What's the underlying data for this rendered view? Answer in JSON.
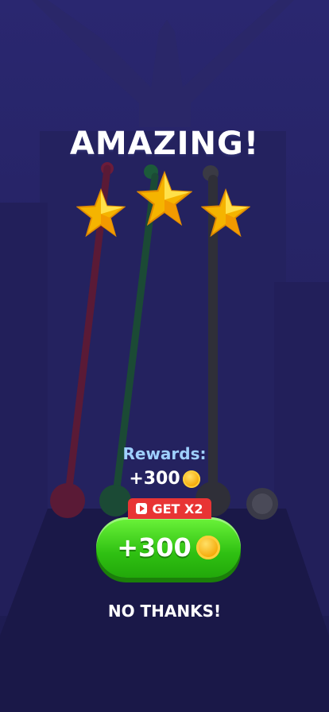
{
  "title": "AMAZING!",
  "stars_earned": 3,
  "stars_total": 3,
  "rewards": {
    "label": "Rewards:",
    "amount": "+300"
  },
  "offer": {
    "badge_label": "GET X2",
    "badge_icon": "play-video-icon",
    "button_amount": "+300",
    "coin_icon": "coin-icon"
  },
  "decline_label": "NO THANKS!",
  "colors": {
    "background": "#1f1d55",
    "button_green": "#2fc012",
    "badge_red": "#e83434",
    "rewards_label": "#9fd0ff",
    "star_gold": "#f7c21a"
  }
}
